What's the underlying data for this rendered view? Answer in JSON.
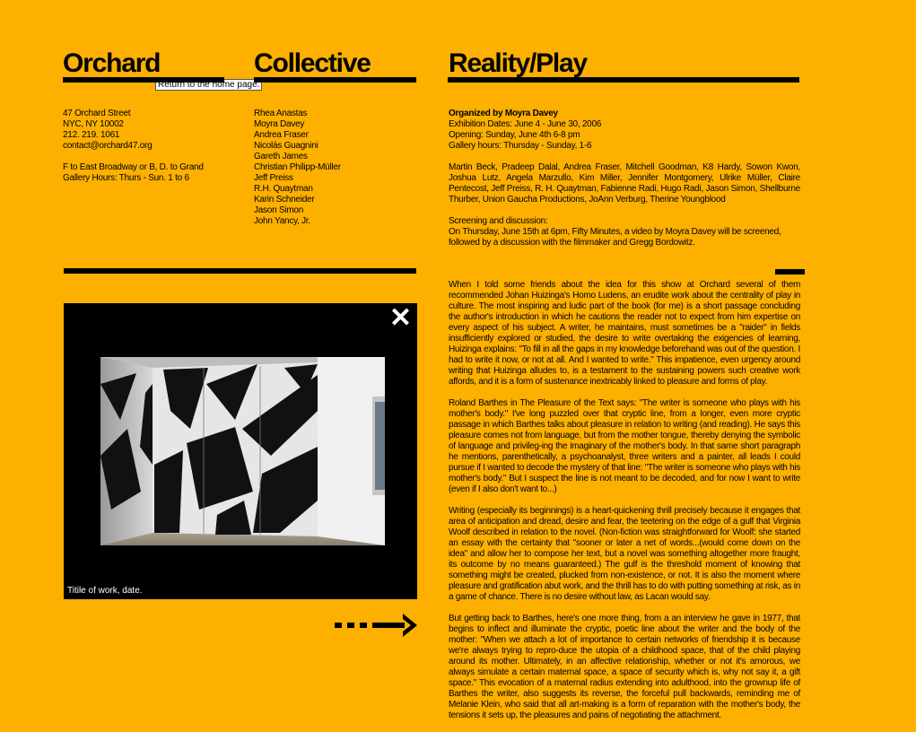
{
  "header": {
    "brand_left": "Orchard",
    "brand_right": "Collective",
    "tooltip": "Return to the home page.",
    "title": "Reality/Play"
  },
  "contact": {
    "address_line1": "47 Orchard Street",
    "address_line2": "NYC, NY 10002",
    "phone": "212. 219. 1061",
    "email": "contact@orchard47.org",
    "directions": "F to East Broadway or B, D. to Grand",
    "hours": "Gallery Hours: Thurs - Sun. 1 to 6"
  },
  "members": [
    "Rhea Anastas",
    "Moyra Davey",
    "Andrea Fraser",
    "Nicolás Guagnini",
    "Gareth James",
    "Christian Philipp-Müller",
    "Jeff Preiss",
    "R.H. Quaytman",
    "Karin Schneider",
    "Jason Simon",
    "John Yancy, Jr."
  ],
  "exhibition": {
    "organized_by": "Organized by Moyra Davey",
    "dates": "Exhibition Dates: June 4 - June 30, 2006",
    "opening": "Opening: Sunday, June 4th 6-8 pm",
    "hours": "Gallery hours: Thursday - Sunday, 1-6",
    "artists": "Martin Beck, Pradeep Dalal, Andrea Fraser, Mitchell Goodman, K8 Hardy, Sowon Kwon, Joshua Lutz, Angela Marzullo, Kim Miller, Jennifer Montgomery, Ulrike Müller, Claire Pentecost, Jeff Preiss, R. H. Quaytman, Fabienne Radi, Hugo Radi, Jason Simon, Shellburne Thurber, Union Gaucha Productions, JoAnn Verburg, Therine Youngblood",
    "screening_heading": "Screening and discussion:",
    "screening_line1": "On Thursday, June 15th at 6pm, Fifty Minutes, a video by Moyra Davey will be screened,",
    "screening_line2": "followed by a discussion with the filmmaker and Gregg Bordowitz."
  },
  "essay": [
    "When I told some friends about the idea for this show at Orchard several of them recommended Johan Huizinga's Homo Ludens, an erudite work about the centrality of play in culture. The most inspiring and ludic part of the book (for me) is a short passage concluding the author's introduction in which he cautions the reader not to expect from him expertise on every aspect of his subject. A writer, he maintains, must sometimes be a \"raider\" in fields insufficiently explored or studied, the desire to write overtaking the exigencies of learning, Huizinga explains: \"To fill in all the gaps in my knowledge beforehand was out of the question. I had to write it now, or not at all. And I wanted to write.\" This impatience, even urgency around writing that Huizinga alludes to, is a testament to the sustaining powers such creative work affords, and it is a form of sustenance inextricably linked to pleasure and forms of play.",
    "Roland Barthes in The Pleasure of the Text says: \"The writer is someone who plays with his mother's body.\" I've long puzzled over that cryptic line, from a longer, even more cryptic passage in which Barthes talks about pleasure in relation to writing (and reading). He says this pleasure comes not from language, but from the mother tongue, thereby denying the symbolic of language and privileg-ing the imaginary of the mother's body. In that same short paragraph he mentions, parenthetically, a psychoanalyst, three writers and a painter, all leads I could pursue if I wanted to decode the mystery of that line: \"The writer is someone who plays with his mother's body.\" But I suspect the line is not meant to be decoded, and for now I want to write (even if I also don't want to...)",
    "Writing (especially its beginnings) is a heart-quickening thrill precisely because it engages that area of anticipation and dread, desire and fear, the teetering on the edge of a gulf that Virginia Woolf described in relation to the novel. (Non-fiction was straightforward for Woolf: she started an essay with the certainty that \"sooner or later a net of words...(would come down on the idea\" and allow her to compose her text, but a novel was something altogether more fraught, its outcome by no means guaranteed.) The gulf is the threshold moment of knowing that something might be created, plucked from non-existence, or not. It is also the moment where pleasure and gratification abut work, and the thrill has to do with putting something at risk, as in a game of chance. There is no desire without law, as Lacan would say.",
    "But getting back to Barthes, here's one more thing, from a an interview he gave in 1977, that begins to inflect and illuminate the cryptic, poetic line about the writer and the body of the mother: \"When we attach a lot of importance to certain networks of friendship it is because we're always trying to repro-duce the utopia of a childhood space, that of the child playing around its mother. Ultimately, in an affective relationship, whether or not it's amorous, we always simulate a certain maternal space, a space of security which is, why not say it, a gift space.\" This evocation of a maternal radius extending into adulthood, into the grownup life of Barthes the writer, also suggests its reverse, the forceful pull backwards, reminding me of Melanie Klein, who said that all art-making is a form of reparation with the mother's body, the tensions it sets up, the pleasures and pains of negotiating the attachment."
  ],
  "viewer": {
    "close_glyph": "✕",
    "caption": "Titile of work, date."
  },
  "colors": {
    "background": "#FDB000",
    "ink": "#000000"
  }
}
